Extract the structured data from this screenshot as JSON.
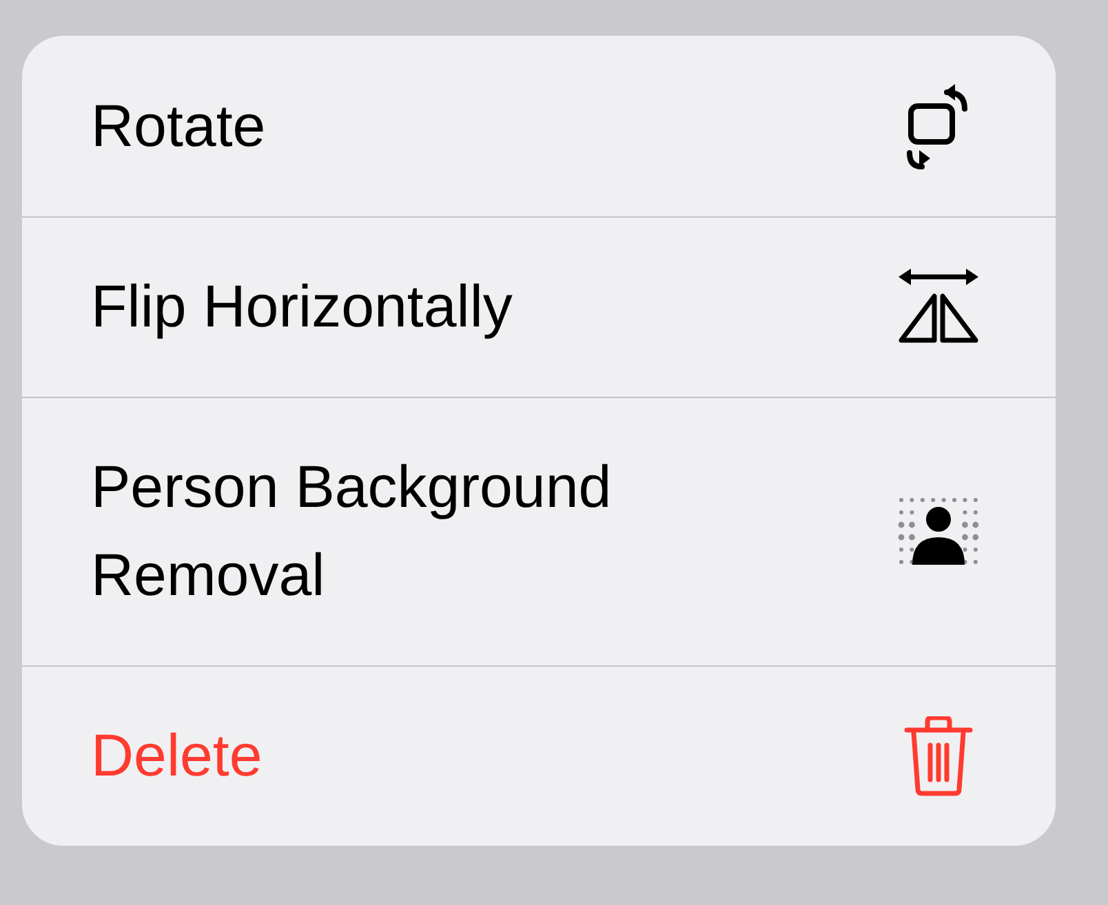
{
  "menu": {
    "items": [
      {
        "label": "Rotate",
        "kind": "rotate",
        "destructive": false
      },
      {
        "label": "Flip Horizontally",
        "kind": "flip",
        "destructive": false
      },
      {
        "label": "Person Background Removal",
        "kind": "person",
        "destructive": false
      },
      {
        "label": "Delete",
        "kind": "delete",
        "destructive": true
      }
    ]
  }
}
